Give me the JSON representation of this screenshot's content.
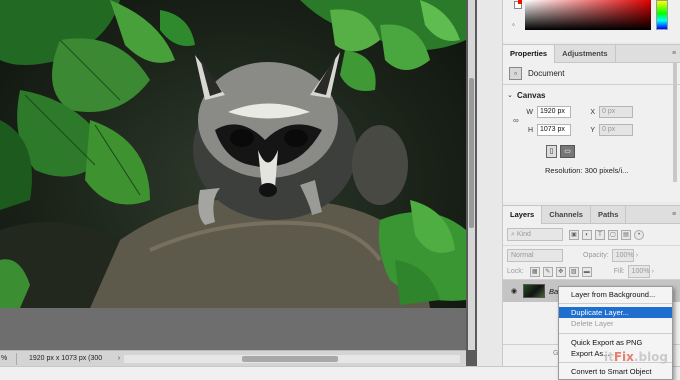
{
  "colors": {
    "accent": "#1f6fd1",
    "panel_bg": "#f0f0f0",
    "layer_selected": "#c4c4c4"
  },
  "status": {
    "zoom": "%",
    "doc_size": "1920 px x 1073 px (300 ppi)",
    "arrow_icon": "›"
  },
  "properties": {
    "tabs": [
      "Properties",
      "Adjustments"
    ],
    "document_label": "Document",
    "canvas_title": "Canvas",
    "width_label": "W",
    "width_value": "1920 px",
    "height_label": "H",
    "height_value": "1073 px",
    "x_label": "X",
    "x_value": "0 px",
    "y_label": "Y",
    "y_value": "0 px",
    "resolution": "Resolution: 300 pixels/i..."
  },
  "layers": {
    "tabs": [
      "Layers",
      "Channels",
      "Paths"
    ],
    "kind_filter": "Kind",
    "blend_mode": "Normal",
    "opacity_label": "Opacity:",
    "opacity_value": "100%",
    "lock_label": "Lock:",
    "fill_label": "Fill:",
    "fill_value": "100%",
    "layer_name": "Ba",
    "bottom_hint": "Gr"
  },
  "context_menu": {
    "items": [
      {
        "label": "Layer from Background...",
        "state": "normal"
      },
      {
        "separator": true
      },
      {
        "label": "Duplicate Layer...",
        "state": "highlighted"
      },
      {
        "label": "Delete Layer",
        "state": "disabled"
      },
      {
        "separator": true
      },
      {
        "label": "Quick Export as PNG",
        "state": "normal"
      },
      {
        "label": "Export As...",
        "state": "normal"
      },
      {
        "separator": true
      },
      {
        "label": "Convert to Smart Object",
        "state": "normal"
      }
    ]
  },
  "watermark": {
    "part1": "it",
    "part2": "Fix",
    "part3": ".blog"
  }
}
